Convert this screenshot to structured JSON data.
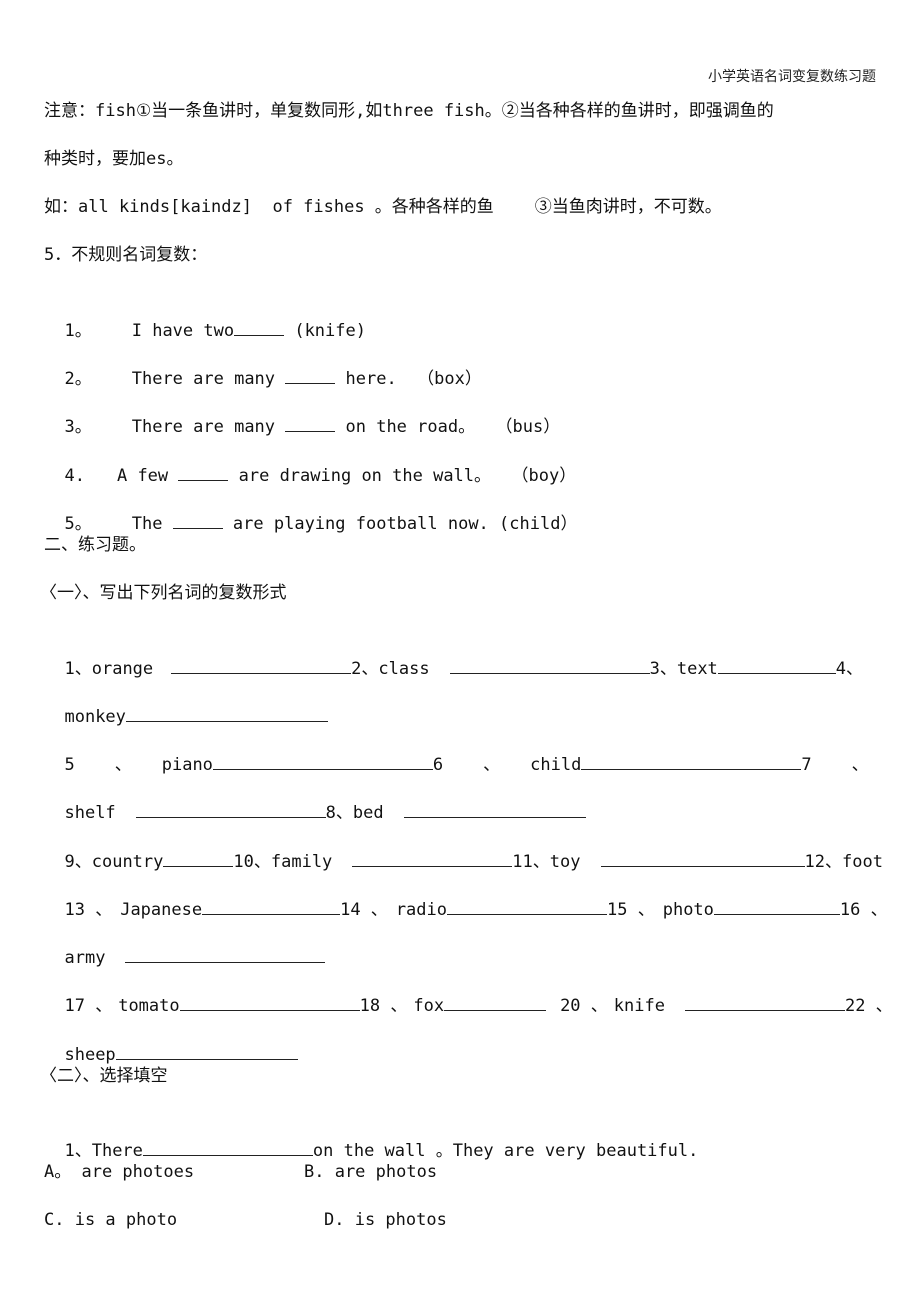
{
  "header": {
    "title": "小学英语名词变复数练习题"
  },
  "note": {
    "line1": "注意：fish①当一条鱼讲时，单复数同形,如three fish。②当各种各样的鱼讲时，即强调鱼的",
    "line2": "种类时，要加es。",
    "line3": "如：all kinds[kaindz]  of fishes 。各种各样的鱼    ③当鱼肉讲时，不可数。"
  },
  "section5": {
    "title": "5．不规则名词复数：",
    "items": [
      {
        "num": "1。",
        "before": "I have two",
        "after": " (knife)"
      },
      {
        "num": "2。",
        "before": "There are many ",
        "after": " here.  （box）"
      },
      {
        "num": "3。",
        "before": "There are many ",
        "after": " on the road。  （bus）"
      },
      {
        "num": "4.",
        "before": "A few ",
        "after": " are drawing on the wall。  （boy）"
      },
      {
        "num": "5。",
        "before": "The ",
        "after": " are playing football now. (child）"
      }
    ]
  },
  "exercises": {
    "title": "二、练习题。",
    "part1": {
      "title": "〈一〉、写出下列名词的复数形式",
      "words": [
        {
          "num": "1、",
          "word": "orange"
        },
        {
          "num": "2、",
          "word": "class"
        },
        {
          "num": "3、",
          "word": "text"
        },
        {
          "num": "4、",
          "word": "monkey"
        },
        {
          "num": "5",
          "word": "piano"
        },
        {
          "num": "6",
          "word": "child"
        },
        {
          "num": "7",
          "word": "shelf"
        },
        {
          "num": "8、",
          "word": "bed"
        },
        {
          "num": "9、",
          "word": "country"
        },
        {
          "num": "10、",
          "word": "family"
        },
        {
          "num": "11、",
          "word": "toy"
        },
        {
          "num": "12、",
          "word": "foot"
        },
        {
          "num": "13 、",
          "word": "Japanese"
        },
        {
          "num": "14 、",
          "word": "radio"
        },
        {
          "num": "15 、",
          "word": "photo"
        },
        {
          "num": "16 、",
          "word": "army"
        },
        {
          "num": "17 、",
          "word": "tomato"
        },
        {
          "num": "18 、",
          "word": "fox"
        },
        {
          "num": "20 、",
          "word": "knife"
        },
        {
          "num": "22 、",
          "word": "sheep"
        }
      ],
      "separator": "、"
    },
    "part2": {
      "title": "〈二〉、选择填空",
      "q1": {
        "stem_before": "1、There",
        "stem_after": "on the wall 。They are very beautiful.",
        "options": [
          {
            "label": "A。 are photoes"
          },
          {
            "label": "B. are photos"
          },
          {
            "label": "C. is a photo"
          },
          {
            "label": "D. is photos"
          }
        ]
      }
    }
  }
}
